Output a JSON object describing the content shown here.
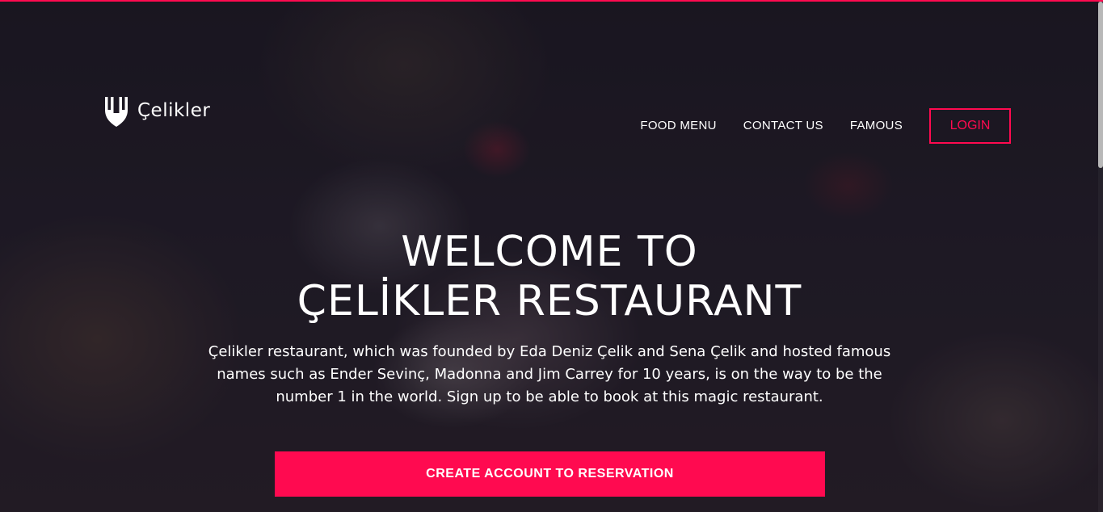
{
  "colors": {
    "accent": "#ff0a50",
    "text": "#ffffff",
    "overlay": "#1d1a24"
  },
  "brand": {
    "name": "Çelikler",
    "icon": "cutlery-icon"
  },
  "nav": {
    "items": [
      {
        "label": "FOOD MENU"
      },
      {
        "label": "CONTACT US"
      },
      {
        "label": "FAMOUS"
      }
    ],
    "login_label": "LOGIN"
  },
  "hero": {
    "title_line1": "WELCOME TO",
    "title_line2": "ÇELİKLER RESTAURANT",
    "description": "Çelikler restaurant, which was founded by Eda Deniz Çelik and Sena Çelik and hosted famous names such as Ender Sevinç, Madonna and Jim Carrey for 10 years, is on the way to be the number 1 in the world. Sign up to be able to book at this magic restaurant.",
    "cta_label": "CREATE ACCOUNT TO RESERVATION"
  }
}
